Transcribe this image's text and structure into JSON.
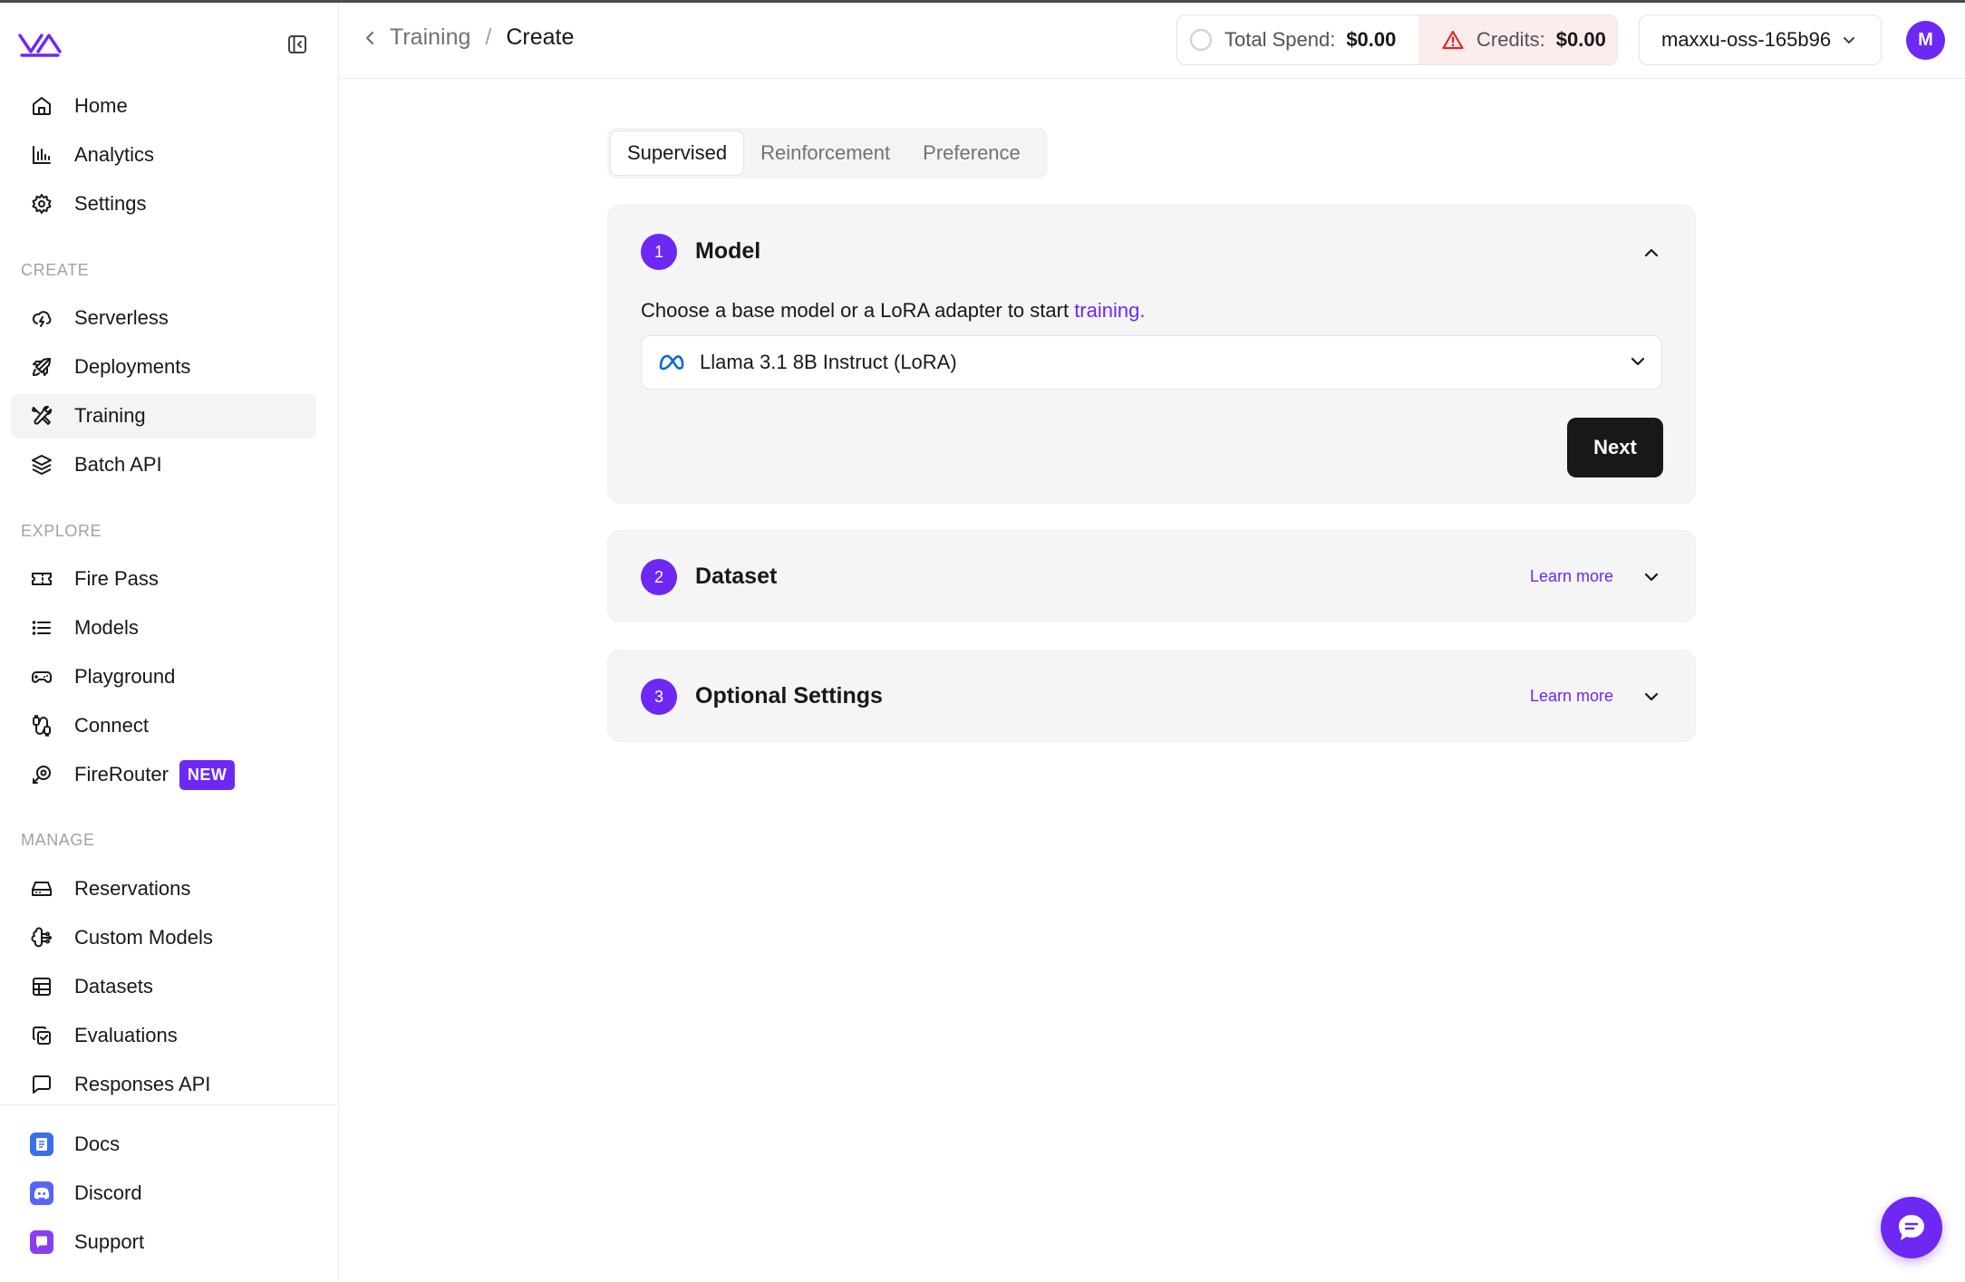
{
  "sidebar": {
    "main": [
      {
        "label": "Home"
      },
      {
        "label": "Analytics"
      },
      {
        "label": "Settings"
      }
    ],
    "sections": {
      "create": "CREATE",
      "explore": "EXPLORE",
      "manage": "MANAGE"
    },
    "create": [
      {
        "label": "Serverless"
      },
      {
        "label": "Deployments"
      },
      {
        "label": "Training"
      },
      {
        "label": "Batch API"
      }
    ],
    "explore": [
      {
        "label": "Fire Pass"
      },
      {
        "label": "Models"
      },
      {
        "label": "Playground"
      },
      {
        "label": "Connect"
      },
      {
        "label": "FireRouter",
        "badge": "NEW"
      }
    ],
    "manage": [
      {
        "label": "Reservations"
      },
      {
        "label": "Custom Models"
      },
      {
        "label": "Datasets"
      },
      {
        "label": "Evaluations"
      },
      {
        "label": "Responses API"
      }
    ],
    "footer": [
      {
        "label": "Docs"
      },
      {
        "label": "Discord"
      },
      {
        "label": "Support"
      }
    ]
  },
  "header": {
    "breadcrumb": [
      "Training",
      "Create"
    ],
    "breadcrumb_sep": "/",
    "total_spend_label": "Total Spend:",
    "total_spend_value": "$0.00",
    "credits_label": "Credits:",
    "credits_value": "$0.00",
    "account": "maxxu-oss-165b96",
    "avatar_initial": "M"
  },
  "tabs": [
    {
      "label": "Supervised",
      "active": true
    },
    {
      "label": "Reinforcement",
      "active": false
    },
    {
      "label": "Preference",
      "active": false
    }
  ],
  "steps": [
    {
      "num": "1",
      "title": "Model",
      "description": "Choose a base model or a LoRA adapter to start ",
      "description_link": "training.",
      "selected_model": "Llama 3.1 8B Instruct (LoRA)",
      "next_label": "Next"
    },
    {
      "num": "2",
      "title": "Dataset",
      "learn_more": "Learn more"
    },
    {
      "num": "3",
      "title": "Optional Settings",
      "learn_more": "Learn more"
    }
  ],
  "colors": {
    "accent": "#6d28f4",
    "credits_bg": "#fdecec",
    "warning": "#dc2626"
  }
}
